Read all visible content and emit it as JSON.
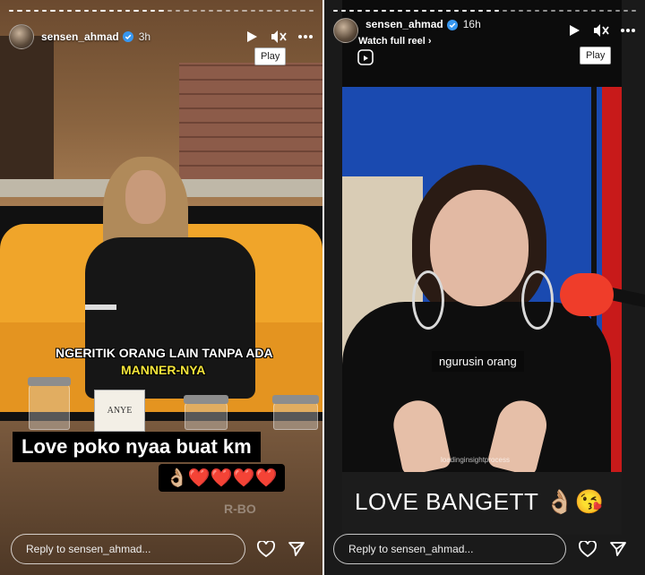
{
  "stories": [
    {
      "username": "sensen_ahmad",
      "time_ago": "3h",
      "tooltip": "Play",
      "caption_line1": "NGERITIK ORANG LAIN TANPA ADA",
      "caption_line2": "MANNER-NYA",
      "text_overlay": "Love  poko nyaa buat km",
      "emoji_row": "👌🏼❤️❤️❤️❤️",
      "napkin_text": "ANYE",
      "watermark": "R-BO",
      "reply_placeholder": "Reply to sensen_ahmad...",
      "progress": [
        1,
        1,
        1,
        1,
        1,
        1,
        1,
        1,
        1,
        1,
        1,
        1,
        1,
        1,
        1,
        1,
        1,
        1,
        1,
        0,
        0,
        0,
        0,
        0,
        0,
        0,
        0,
        0,
        0,
        0,
        0,
        0,
        0,
        0,
        0,
        0,
        0
      ]
    },
    {
      "username": "sensen_ahmad",
      "time_ago": "16h",
      "watch_full_reel": "Watch full reel",
      "tooltip": "Play",
      "subtitle": "ngurusin orang",
      "brand_text": "loadinginsightprocess",
      "text_overlay": "LOVE BANGETT",
      "emoji": "👌🏼😘",
      "reply_placeholder": "Reply to sensen_ahmad...",
      "progress": [
        1,
        1,
        1,
        1,
        1,
        1,
        1,
        1,
        1,
        1,
        1,
        1,
        1,
        1,
        1,
        1,
        1,
        1,
        1,
        1,
        1,
        0,
        0,
        0,
        0,
        0,
        0,
        0,
        0,
        0,
        0,
        0,
        0,
        0,
        0,
        0,
        0,
        0
      ]
    }
  ],
  "icons": [
    "play-icon",
    "mute-icon",
    "more-icon",
    "heart-icon",
    "send-icon",
    "verified-icon",
    "reel-icon"
  ],
  "colors": {
    "verified": "#3797f0",
    "couch": "#f0a52a",
    "studio_blue": "#1a4ab0"
  }
}
